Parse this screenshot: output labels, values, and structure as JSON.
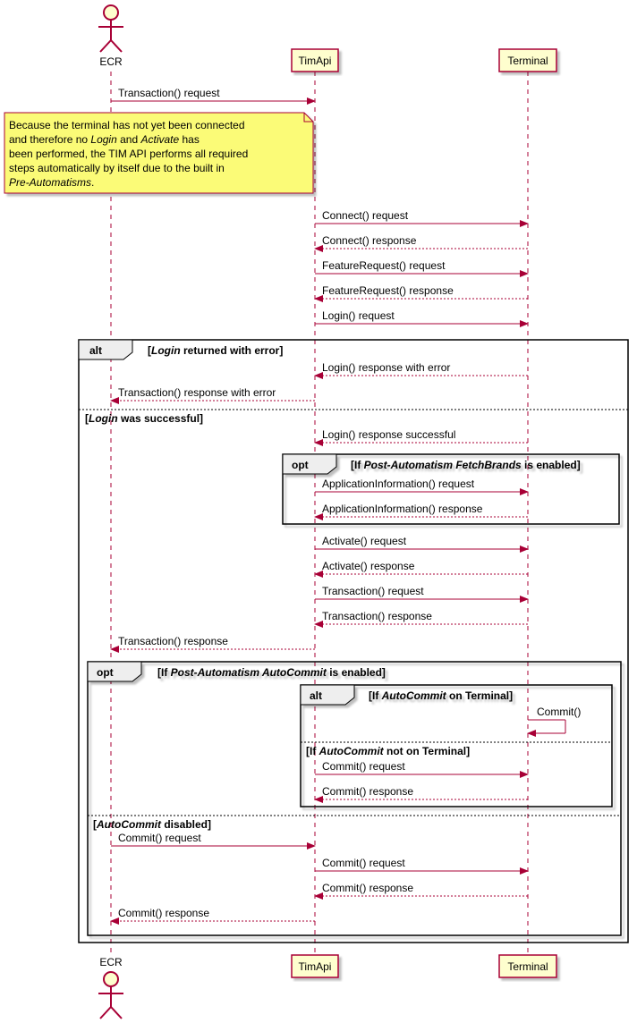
{
  "actors": {
    "ecr": "ECR",
    "timapi": "TimApi",
    "terminal": "Terminal"
  },
  "note": {
    "l1": "Because the terminal has not yet been connected",
    "l2a": "and therefore no ",
    "l2b": "Login",
    "l2c": " and ",
    "l2d": "Activate",
    "l2e": " has",
    "l3": "been performed, the TIM API performs all required",
    "l4": "steps automatically by itself due to the built in",
    "l5": "Pre-Automatisms",
    "l5b": "."
  },
  "msgs": {
    "m1": "Transaction() request",
    "m2": "Connect() request",
    "m3": "Connect() response",
    "m4": "FeatureRequest() request",
    "m5": "FeatureRequest() response",
    "m6": "Login() request",
    "m7": "Login() response with error",
    "m8": "Transaction() response with error",
    "m9": "Login() response successful",
    "m10": "ApplicationInformation() request",
    "m11": "ApplicationInformation() response",
    "m12": "Activate() request",
    "m13": "Activate() response",
    "m14": "Transaction() request",
    "m15": "Transaction() response",
    "m16": "Transaction() response",
    "m17": "Commit()",
    "m18": "Commit() request",
    "m19": "Commit() response",
    "m20": "Commit() request",
    "m21": "Commit() request",
    "m22": "Commit() response",
    "m23": "Commit() response"
  },
  "frags": {
    "alt1": "alt",
    "alt1_g1a": "[",
    "alt1_g1b": "Login",
    "alt1_g1c": " returned with error]",
    "alt1_g2a": "[",
    "alt1_g2b": "Login",
    "alt1_g2c": " was successful]",
    "opt1": "opt",
    "opt1_g1a": "[If ",
    "opt1_g1b": "Post-Automatism FetchBrands",
    "opt1_g1c": " is enabled]",
    "opt2": "opt",
    "opt2_g1a": "[If ",
    "opt2_g1b": "Post-Automatism AutoCommit",
    "opt2_g1c": " is enabled]",
    "alt2": "alt",
    "alt2_g1a": "[If ",
    "alt2_g1b": "AutoCommit",
    "alt2_g1c": " on Terminal]",
    "alt2_g2a": "[If ",
    "alt2_g2b": "AutoCommit",
    "alt2_g2c": " not on Terminal]",
    "opt2_g2a": "[",
    "opt2_g2b": "AutoCommit",
    "opt2_g2c": " disabled]"
  }
}
